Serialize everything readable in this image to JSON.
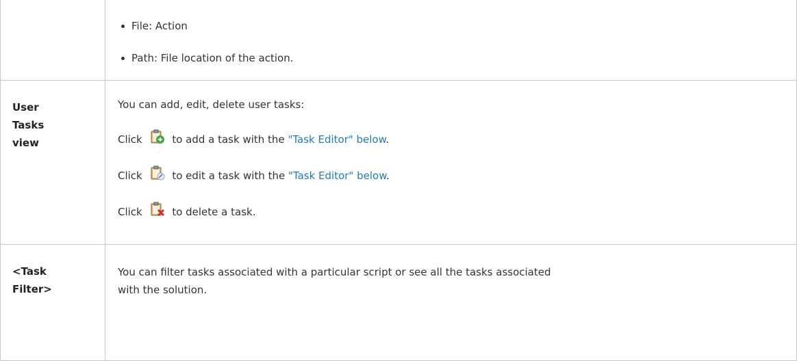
{
  "row1": {
    "bullets": [
      "File: Action",
      "Path: File location of the action."
    ]
  },
  "row2": {
    "label_lines": [
      "User",
      "Tasks",
      "view"
    ],
    "intro": "You can add, edit, delete user tasks:",
    "click": "Click",
    "add_text": "to add a task with the",
    "edit_text": "to edit a task with the",
    "delete_text": "to delete a task.",
    "link": "\"Task Editor\" below",
    "period": ".",
    "icons": [
      "add-task-icon",
      "edit-task-icon",
      "delete-task-icon"
    ]
  },
  "row3": {
    "label_lines": [
      "<Task",
      "Filter>"
    ],
    "text_line1": "You can filter tasks associated with a particular script or see all the tasks associated",
    "text_line2": "with the solution."
  },
  "colors": {
    "link": "#1e7bbf",
    "border": "#c8c8c8"
  }
}
